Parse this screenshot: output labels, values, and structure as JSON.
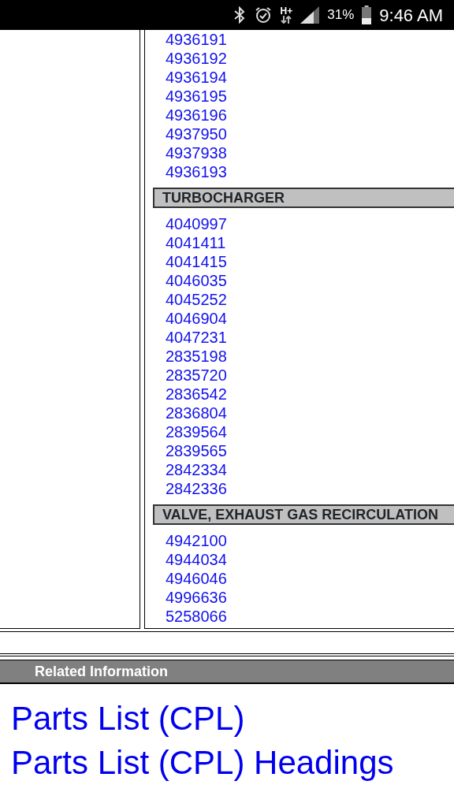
{
  "status_bar": {
    "network_type": "H+",
    "battery": "31%",
    "time": "9:46 AM"
  },
  "part_groups": [
    {
      "parts": [
        "4936191",
        "4936192",
        "4936194",
        "4936195",
        "4936196",
        "4937950",
        "4937938",
        "4936193"
      ]
    },
    {
      "heading": "TURBOCHARGER",
      "parts": [
        "4040997",
        "4041411",
        "4041415",
        "4046035",
        "4045252",
        "4046904",
        "4047231",
        "2835198",
        "2835720",
        "2836542",
        "2836804",
        "2839564",
        "2839565",
        "2842334",
        "2842336"
      ]
    },
    {
      "heading": "VALVE, EXHAUST GAS RECIRCULATION",
      "parts": [
        "4942100",
        "4944034",
        "4946046",
        "4996636",
        "5258066"
      ]
    }
  ],
  "related": {
    "title": "Related Information",
    "links": [
      "Parts List (CPL)",
      "Parts List (CPL) Headings"
    ]
  }
}
